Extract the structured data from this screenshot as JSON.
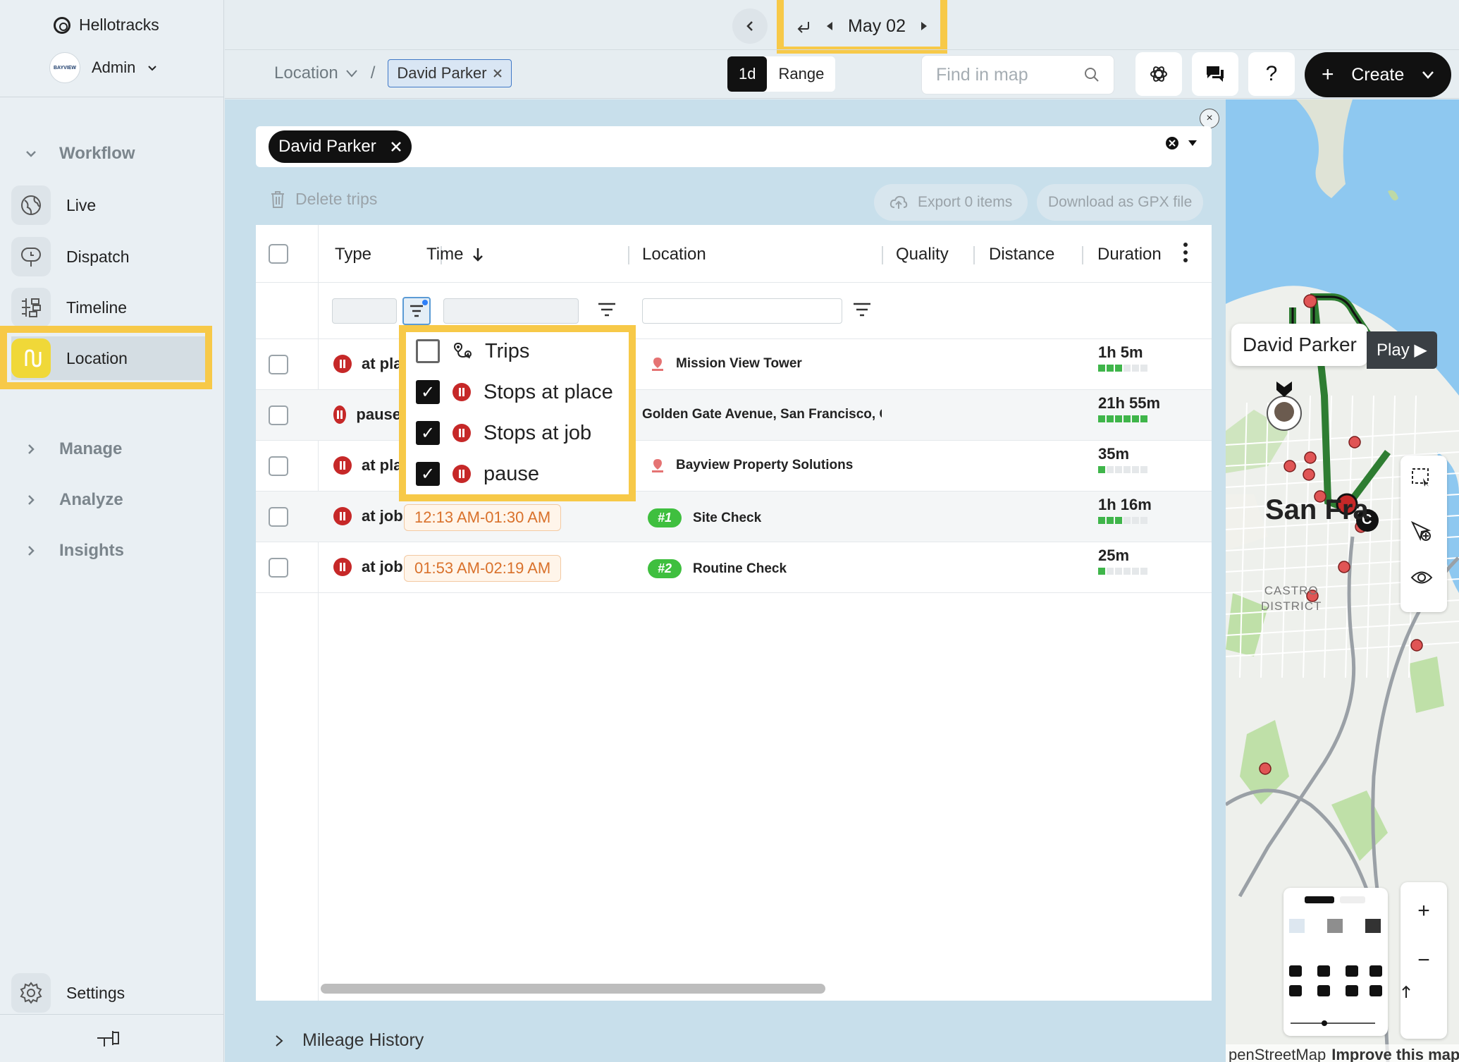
{
  "app": {
    "name": "Hellotracks",
    "org_badge": "BAYVIEW",
    "user_role": "Admin"
  },
  "sidebar": {
    "sections": [
      {
        "label": "Workflow",
        "expanded": true
      },
      {
        "label": "Manage",
        "expanded": false
      },
      {
        "label": "Analyze",
        "expanded": false
      },
      {
        "label": "Insights",
        "expanded": false
      }
    ],
    "items": [
      {
        "label": "Live",
        "icon": "live-globe-icon"
      },
      {
        "label": "Dispatch",
        "icon": "dispatch-icon"
      },
      {
        "label": "Timeline",
        "icon": "timeline-icon"
      },
      {
        "label": "Location",
        "icon": "location-route-icon",
        "active": true
      }
    ],
    "settings_label": "Settings"
  },
  "topbar": {
    "date": "May 02",
    "breadcrumb_root": "Location",
    "breadcrumb_chip": "David Parker",
    "mode_1d": "1d",
    "mode_range": "Range",
    "active_mode": "1d",
    "find_placeholder": "Find in map",
    "help_label": "?",
    "create_label": "Create"
  },
  "selection": {
    "chip": "David Parker"
  },
  "actions": {
    "delete_label": "Delete trips",
    "export_label": "Export 0 items",
    "gpx_label": "Download as GPX file"
  },
  "table": {
    "columns": [
      "Type",
      "Time",
      "Location",
      "Quality",
      "Distance",
      "Duration"
    ],
    "sort_column": "Time",
    "rows": [
      {
        "type": "at place",
        "time": "",
        "location": "Mission View Tower",
        "loc_kind": "place",
        "duration": "1h 5m",
        "quality_bars": 3
      },
      {
        "type": "pause",
        "time": "",
        "location": "Golden Gate Avenue, San Francisco, Ca",
        "loc_kind": "none",
        "duration": "21h 55m",
        "quality_bars": 5
      },
      {
        "type": "at place",
        "time": "",
        "location": "Bayview Property Solutions",
        "loc_kind": "place",
        "duration": "35m",
        "quality_bars": 1
      },
      {
        "type": "at job",
        "time": "12:13 AM-01:30 AM",
        "location": "Site Check",
        "loc_kind": "job",
        "badge": "#1",
        "duration": "1h 16m",
        "quality_bars": 3
      },
      {
        "type": "at job",
        "time": "01:53 AM-02:19 AM",
        "location": "Routine Check",
        "loc_kind": "job",
        "badge": "#2",
        "duration": "25m",
        "quality_bars": 1
      }
    ]
  },
  "type_filter": {
    "options": [
      {
        "label": "Trips",
        "checked": false,
        "icon": "route-pin-icon"
      },
      {
        "label": "Stops at place",
        "checked": true,
        "icon": "stop-icon"
      },
      {
        "label": "Stops at job",
        "checked": true,
        "icon": "stop-icon"
      },
      {
        "label": "pause",
        "checked": true,
        "icon": "stop-icon"
      }
    ]
  },
  "footer": {
    "mileage_label": "Mileage History"
  },
  "map": {
    "tooltip_name": "David Parker",
    "play_label": "Play",
    "city_label": "San Fra",
    "district_label_1": "CASTRO",
    "district_label_2": "DISTRICT",
    "attribution": "penStreetMap",
    "improve_label": "Improve this map",
    "marker_c": "C"
  },
  "colors": {
    "accent_yellow": "#f7c948",
    "stop_red": "#c62828",
    "time_orange": "#d9712b",
    "job_green": "#3fbf3f",
    "route_green": "#3fb54a"
  }
}
